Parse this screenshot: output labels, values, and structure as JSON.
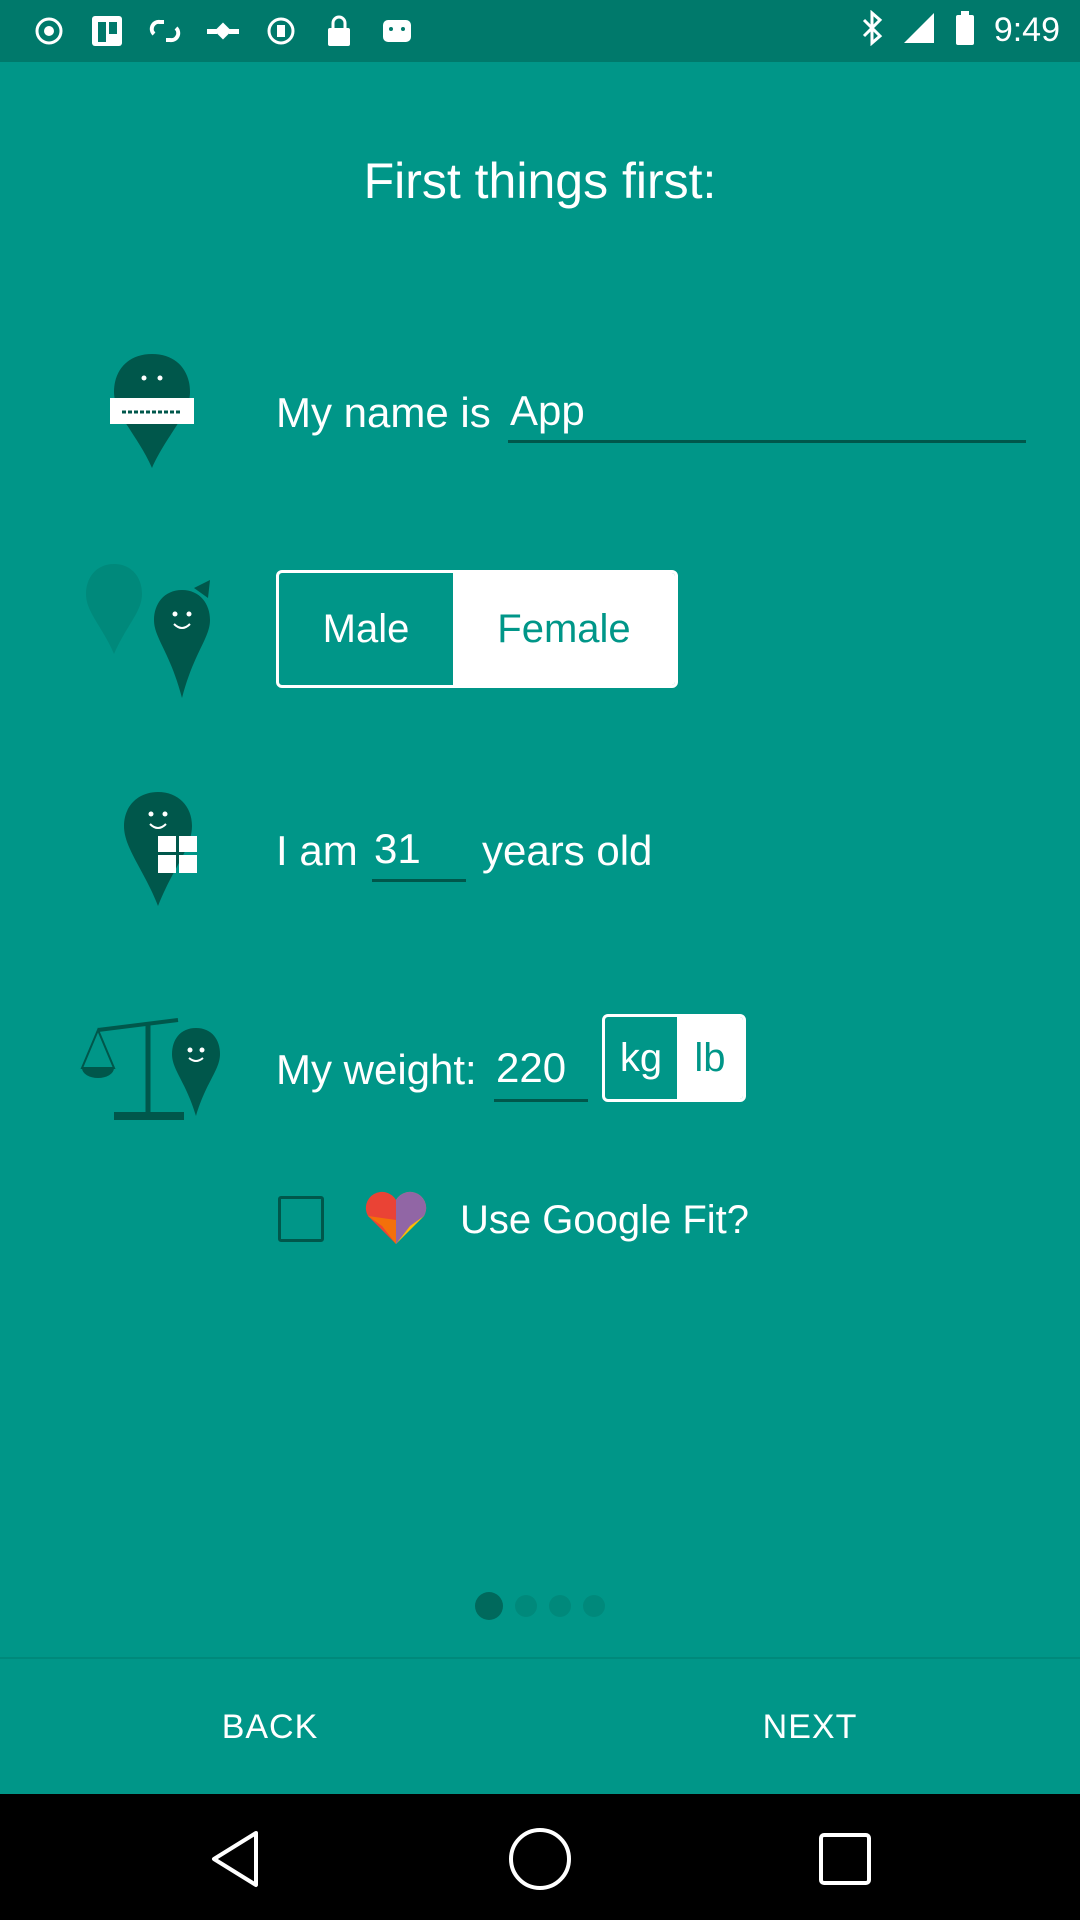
{
  "status_bar": {
    "time": "9:49"
  },
  "title": "First things first:",
  "name_row": {
    "label": "My name is",
    "value": "App"
  },
  "gender_row": {
    "male_label": "Male",
    "female_label": "Female",
    "selected": "Female"
  },
  "age_row": {
    "prefix": "I am",
    "value": "31",
    "suffix": "years old"
  },
  "weight_row": {
    "label": "My weight:",
    "value": "220",
    "unit_kg": "kg",
    "unit_lb": "lb",
    "selected_unit": "lb"
  },
  "google_fit": {
    "label": "Use Google Fit?",
    "checked": false
  },
  "pager": {
    "total": 4,
    "current": 1
  },
  "bottom": {
    "back_label": "BACK",
    "next_label": "NEXT"
  },
  "colors": {
    "background": "#009688",
    "status_bar": "#00796B",
    "dark_accent": "#00574B"
  }
}
